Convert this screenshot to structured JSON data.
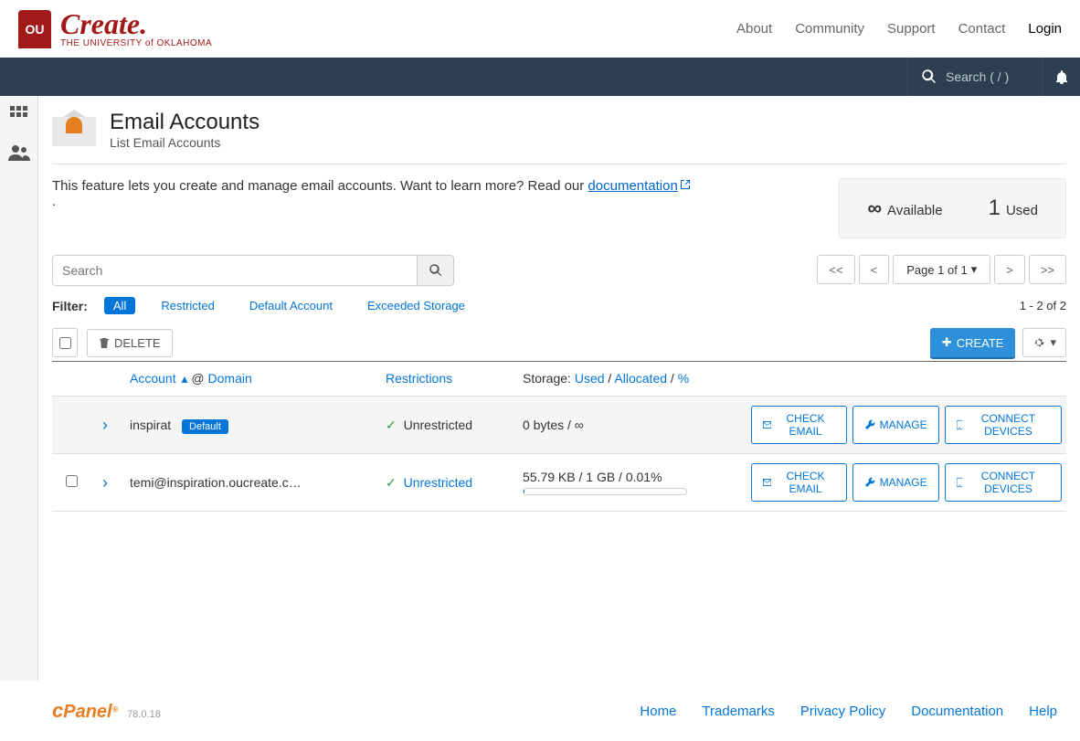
{
  "brand": {
    "ou": "OU",
    "create": "Create.",
    "sub": "THE UNIVERSITY of OKLAHOMA"
  },
  "nav": {
    "about": "About",
    "community": "Community",
    "support": "Support",
    "contact": "Contact",
    "login": "Login"
  },
  "search": {
    "placeholder": "Search ( / )"
  },
  "page": {
    "title": "Email Accounts",
    "subtitle": "List Email Accounts",
    "intro_pre": "This feature lets you create and manage email accounts. Want to learn more? Read our ",
    "doc_link": "documentation",
    "intro_post": " ."
  },
  "stats": {
    "available_value": "∞",
    "available_label": "Available",
    "used_value": "1",
    "used_label": "Used"
  },
  "searchbox": {
    "placeholder": "Search"
  },
  "pager": {
    "first": "<<",
    "prev": "<",
    "label": "Page 1 of 1",
    "next": ">",
    "last": ">>"
  },
  "filter": {
    "label": "Filter:",
    "all": "All",
    "restricted": "Restricted",
    "default": "Default Account",
    "exceeded": "Exceeded Storage",
    "count": "1 - 2 of 2"
  },
  "actions": {
    "delete": "DELETE",
    "create": "CREATE"
  },
  "thead": {
    "account": "Account",
    "at": "@",
    "domain": "Domain",
    "restrictions": "Restrictions",
    "storage": "Storage:",
    "used": "Used",
    "sep": "/",
    "allocated": "Allocated",
    "pct": "%"
  },
  "row_actions": {
    "check": "CHECK EMAIL",
    "manage": "MANAGE",
    "connect": "CONNECT DEVICES"
  },
  "rows": [
    {
      "account": "inspirat",
      "default_badge": "Default",
      "restriction": "Unrestricted",
      "storage_text": "0 bytes / ∞"
    },
    {
      "account": "temi@inspiration.oucreate.c…",
      "restriction": "Unrestricted",
      "storage_text": "55.79 KB / 1 GB / 0.01%"
    }
  ],
  "footer": {
    "cpanel_c": "c",
    "cpanel_p": "Panel",
    "version": "78.0.18",
    "links": {
      "home": "Home",
      "trademarks": "Trademarks",
      "privacy": "Privacy Policy",
      "documentation": "Documentation",
      "help": "Help"
    }
  }
}
